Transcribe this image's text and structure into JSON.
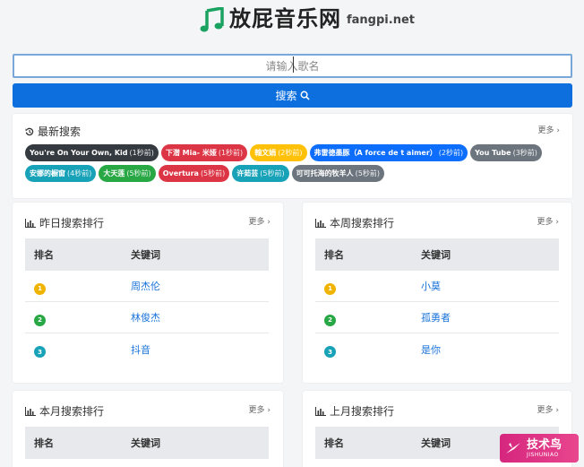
{
  "header": {
    "site_name": "放屁音乐网",
    "domain": "fangpi.net",
    "logo_icon": "music-note-icon",
    "accent": "#1aa261"
  },
  "search": {
    "placeholder": "请输入歌名",
    "button_label": "搜索",
    "button_color": "#0d6fde"
  },
  "latest": {
    "title": "最新搜索",
    "more": "更多 ›",
    "items": [
      {
        "text": "You're On Your Own, Kid",
        "time": "(1秒前)",
        "color": "#343a40"
      },
      {
        "text": "下潜 Mia- 米娅",
        "time": "(1秒前)",
        "color": "#dc3545"
      },
      {
        "text": "翰文娟",
        "time": "(2秒前)",
        "color": "#ffc107"
      },
      {
        "text": "弗雷德墨豚（A force de t aimer）",
        "time": "(2秒前)",
        "color": "#0d6efd"
      },
      {
        "text": "You Tube",
        "time": "(3秒前)",
        "color": "#6c757d"
      },
      {
        "text": "安娜的橱窗",
        "time": "(4秒前)",
        "color": "#17a2b8"
      },
      {
        "text": "大天莲",
        "time": "(5秒前)",
        "color": "#28a745"
      },
      {
        "text": "Overtura",
        "time": "(5秒前)",
        "color": "#dc3545"
      },
      {
        "text": "许茹芸",
        "time": "(5秒前)",
        "color": "#17a2b8"
      },
      {
        "text": "可可托海的牧羊人",
        "time": "(5秒前)",
        "color": "#6c757d"
      }
    ]
  },
  "rank_columns": {
    "rank": "排名",
    "keyword": "关键词"
  },
  "yesterday": {
    "title": "昨日搜索排行",
    "more": "更多 ›",
    "rows": [
      {
        "n": "1",
        "kw": "周杰伦",
        "color": "#f0b400"
      },
      {
        "n": "2",
        "kw": "林俊杰",
        "color": "#28a745"
      },
      {
        "n": "3",
        "kw": "抖音",
        "color": "#17a2b8"
      }
    ]
  },
  "week": {
    "title": "本周搜索排行",
    "more": "更多 ›",
    "rows": [
      {
        "n": "1",
        "kw": "小莫",
        "color": "#f0b400"
      },
      {
        "n": "2",
        "kw": "孤勇者",
        "color": "#28a745"
      },
      {
        "n": "3",
        "kw": "是你",
        "color": "#17a2b8"
      }
    ]
  },
  "month": {
    "title": "本月搜索排行",
    "more": "更多 ›"
  },
  "last_month": {
    "title": "上月搜索排行",
    "more": "更多 ›"
  },
  "watermark": {
    "main": "技术鸟",
    "sub": "JISHUNIAO"
  }
}
